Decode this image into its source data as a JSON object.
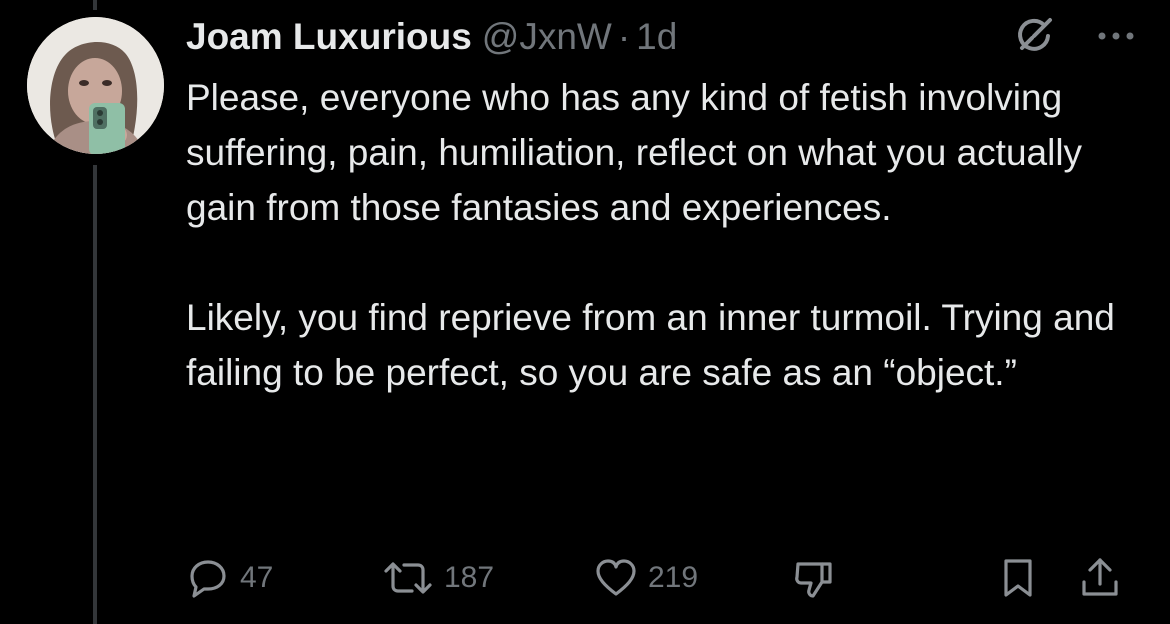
{
  "author": {
    "display_name": "Joam Luxurious",
    "handle": "@JxnW",
    "separator": "·",
    "time": "1d"
  },
  "tweet": {
    "text": "Please, everyone who has any kind of fetish involving suffering, pain, humiliation, reflect on what you actually gain from those fantasies and experiences.\n\nLikely, you find reprieve from an inner turmoil. Trying and failing to be perfect, so you are safe as an “object.”"
  },
  "actions": {
    "replies": "47",
    "reposts": "187",
    "likes": "219"
  },
  "icons": {
    "grok": "grok-icon",
    "more": "more-options-icon",
    "reply": "reply-icon",
    "repost": "repost-icon",
    "like": "heart-icon",
    "dislike": "thumbs-down-icon",
    "bookmark": "bookmark-icon",
    "share": "share-icon"
  },
  "colors": {
    "background": "#000000",
    "primary_text": "#e7e9ea",
    "secondary_text": "#71767b",
    "thread_line": "#333639"
  }
}
